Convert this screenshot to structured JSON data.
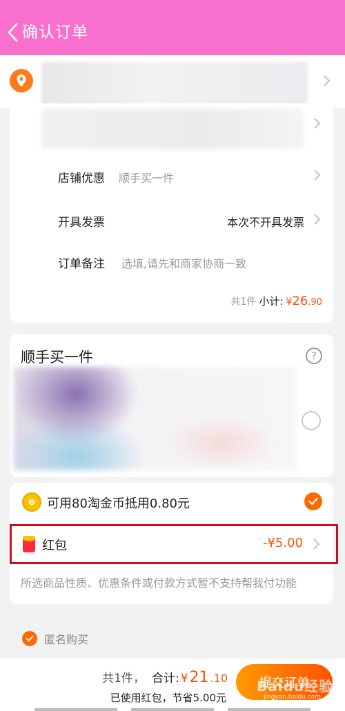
{
  "header": {
    "title": "确认订单",
    "background": "#f86fcd"
  },
  "order": {
    "store_discount_label": "店铺优惠",
    "store_discount_value": "顺手买一件",
    "invoice_label": "开具发票",
    "invoice_value": "本次不开具发票",
    "remark_label": "订单备注",
    "remark_placeholder": "选填,请先和商家协商一致",
    "subtotal_count": "共1件",
    "subtotal_label": "小计:",
    "subtotal_yen": "¥",
    "subtotal_amount": "26",
    "subtotal_cents": ".90"
  },
  "shunshou": {
    "title": "顺手买一件",
    "help_symbol": "?"
  },
  "payment": {
    "coin_symbol": "⊜",
    "coin_text": "可用80淘金币抵用0.80元",
    "hongbao_label": "红包",
    "hongbao_amount": "-¥5.00",
    "note": "所选商品性质、优惠条件或付款方式暂不支持帮我付功能"
  },
  "anonymous": {
    "label": "匿名购买"
  },
  "bottom": {
    "count": "共1件，",
    "total_label": "合计:",
    "total_yen": "¥",
    "total_amount": "21",
    "total_cents": ".10",
    "saved_text": "已使用红包，节省5.00元",
    "submit_label": "提交订单"
  },
  "watermark": {
    "brand": "Baidu经验",
    "url": "jingyan.baidu.com"
  },
  "colors": {
    "accent": "#ff5000",
    "check": "#ff6a00",
    "highlight_box": "#c8101a"
  }
}
